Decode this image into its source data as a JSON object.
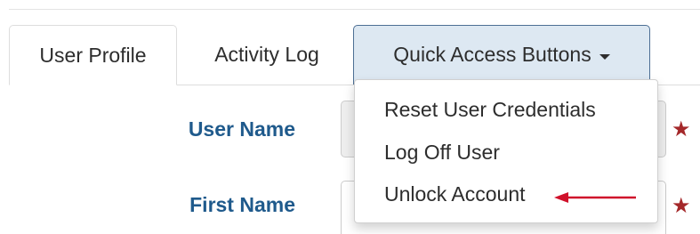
{
  "tabs": [
    {
      "label": "User Profile"
    },
    {
      "label": "Activity Log"
    },
    {
      "label": "Quick Access Buttons"
    }
  ],
  "dropdown": {
    "items": [
      {
        "label": "Reset User Credentials"
      },
      {
        "label": "Log Off User"
      },
      {
        "label": "Unlock Account"
      }
    ]
  },
  "form": {
    "user_name_label": "User Name",
    "first_name_label": "First Name",
    "required_marker": "★"
  },
  "colors": {
    "label_blue": "#1f5a8c",
    "active_dropdown_bg": "#dde8f2",
    "required_star": "#a4282a",
    "annotation_arrow": "#d0112b"
  },
  "icons": {
    "dropdown_caret": "caret-down-icon",
    "annotation": "red-arrow-icon"
  }
}
